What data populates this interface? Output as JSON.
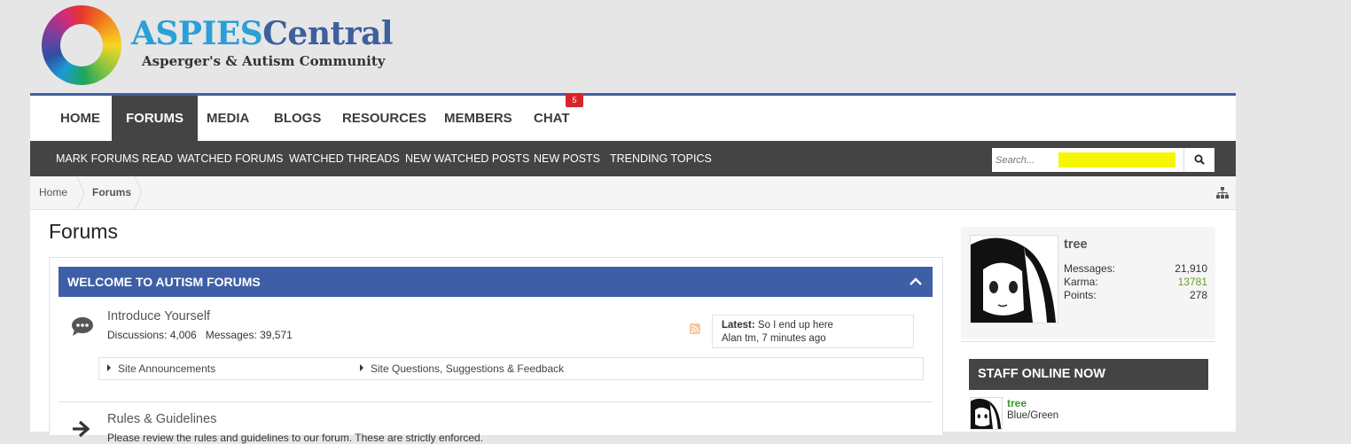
{
  "logo": {
    "title_part1": "ASPIES",
    "title_part2": "Central",
    "subtitle": "Asperger's & Autism Community"
  },
  "nav": {
    "items": [
      {
        "label": "HOME"
      },
      {
        "label": "FORUMS",
        "active": true
      },
      {
        "label": "MEDIA"
      },
      {
        "label": "BLOGS"
      },
      {
        "label": "RESOURCES"
      },
      {
        "label": "MEMBERS"
      },
      {
        "label": "CHAT",
        "badge": "5"
      }
    ]
  },
  "subnav": {
    "items": [
      {
        "label": "Mark Forums Read"
      },
      {
        "label": "Watched Forums"
      },
      {
        "label": "Watched Threads"
      },
      {
        "label": "New Watched Posts"
      },
      {
        "label": "New Posts"
      },
      {
        "label": "Trending Topics"
      }
    ],
    "search_placeholder": "Search..."
  },
  "breadcrumb": {
    "items": [
      {
        "label": "Home"
      },
      {
        "label": "Forums"
      }
    ]
  },
  "page": {
    "title": "Forums"
  },
  "category": {
    "title": "WELCOME TO AUTISM FORUMS",
    "forums": [
      {
        "title": "Introduce Yourself",
        "discussions_label": "Discussions:",
        "discussions": "4,006",
        "messages_label": "Messages:",
        "messages": "39,571",
        "latest_label": "Latest:",
        "latest_title": "So I end up here",
        "latest_meta": "Alan tm, 7 minutes ago",
        "sub_forums": [
          "Site Announcements",
          "Site Questions, Suggestions & Feedback"
        ]
      },
      {
        "title": "Rules & Guidelines",
        "description": "Please review the rules and guidelines to our forum. These are strictly enforced."
      }
    ]
  },
  "sidebar": {
    "user": {
      "name": "tree",
      "stats": [
        {
          "label": "Messages:",
          "value": "21,910"
        },
        {
          "label": "Karma:",
          "value": "13781"
        },
        {
          "label": "Points:",
          "value": "278"
        }
      ]
    },
    "staff_online": {
      "title": "STAFF ONLINE NOW",
      "members": [
        {
          "name": "tree",
          "title": "Blue/Green"
        }
      ]
    }
  },
  "colors": {
    "brand_blue": "#3e5fa6",
    "logo_light_blue": "#2a9fd8",
    "dark_bar": "#444444",
    "badge_red": "#d6262b",
    "karma_green": "#6a9f20",
    "staff_green": "#3a9a2a"
  }
}
